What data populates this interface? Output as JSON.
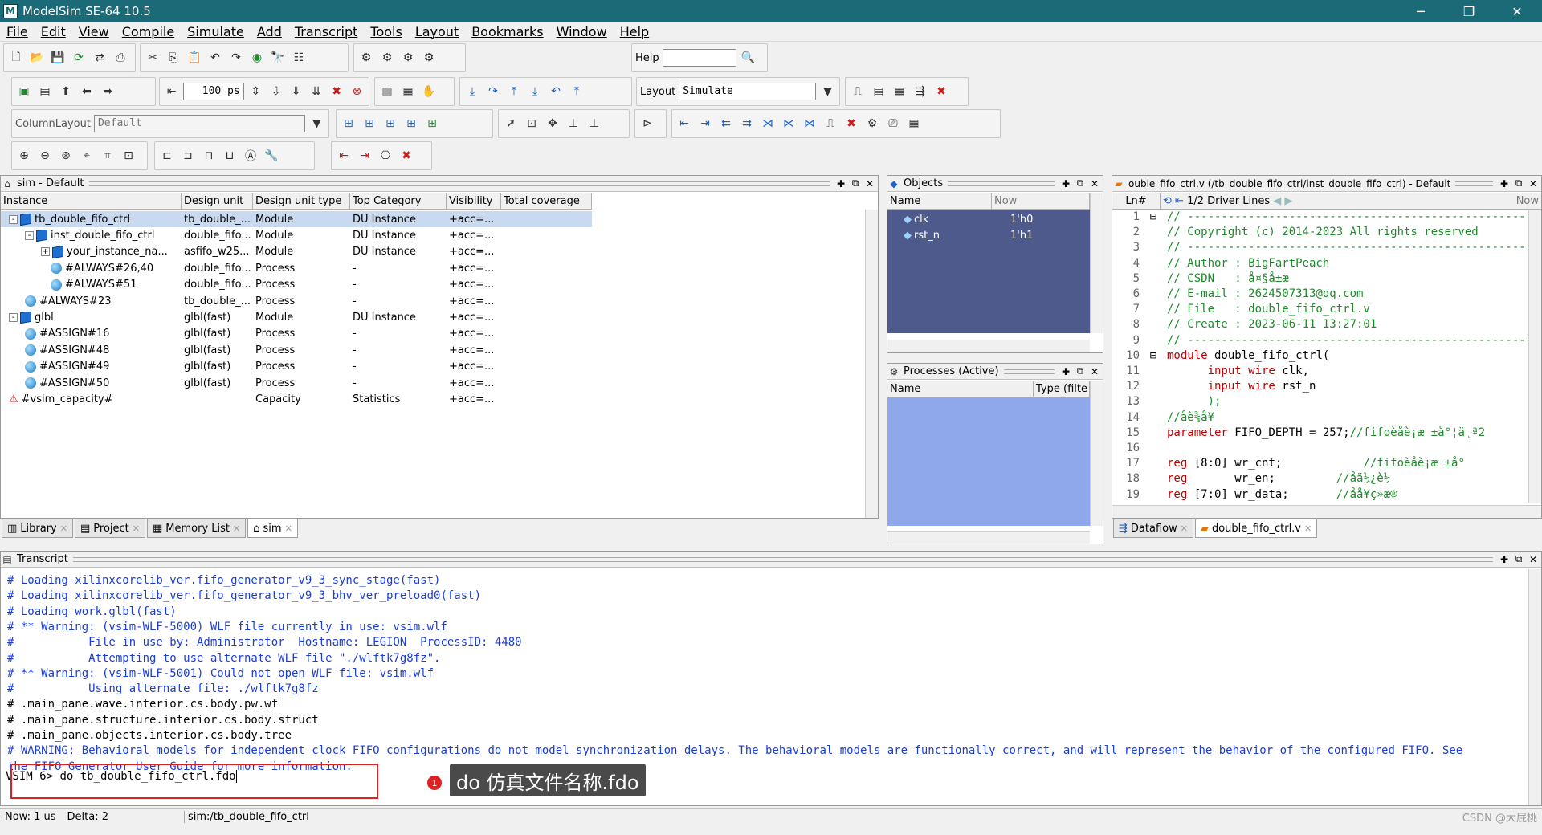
{
  "window": {
    "title": "ModelSim SE-64 10.5",
    "app_icon": "M"
  },
  "menu": [
    "File",
    "Edit",
    "View",
    "Compile",
    "Simulate",
    "Add",
    "Transcript",
    "Tools",
    "Layout",
    "Bookmarks",
    "Window",
    "Help"
  ],
  "toolbar": {
    "help_label": "Help",
    "run_length": "100 ps",
    "layout_label": "Layout",
    "layout_value": "Simulate",
    "column_layout_label": "ColumnLayout",
    "column_layout_value": "Default"
  },
  "sim_panel": {
    "title": "sim - Default",
    "columns": [
      "Instance",
      "Design unit",
      "Design unit type",
      "Top Category",
      "Visibility",
      "Total coverage"
    ],
    "rows": [
      {
        "name": "tb_double_fifo_ctrl",
        "unit": "tb_double_...",
        "type": "Module",
        "cat": "DU Instance",
        "vis": "+acc=..."
      },
      {
        "name": "inst_double_fifo_ctrl",
        "unit": "double_fifo...",
        "type": "Module",
        "cat": "DU Instance",
        "vis": "+acc=..."
      },
      {
        "name": "your_instance_na...",
        "unit": "asfifo_w25...",
        "type": "Module",
        "cat": "DU Instance",
        "vis": "+acc=..."
      },
      {
        "name": "#ALWAYS#26,40",
        "unit": "double_fifo...",
        "type": "Process",
        "cat": "-",
        "vis": "+acc=..."
      },
      {
        "name": "#ALWAYS#51",
        "unit": "double_fifo...",
        "type": "Process",
        "cat": "-",
        "vis": "+acc=..."
      },
      {
        "name": "#ALWAYS#23",
        "unit": "tb_double_...",
        "type": "Process",
        "cat": "-",
        "vis": "+acc=..."
      },
      {
        "name": "glbl",
        "unit": "glbl(fast)",
        "type": "Module",
        "cat": "DU Instance",
        "vis": "+acc=..."
      },
      {
        "name": "#ASSIGN#16",
        "unit": "glbl(fast)",
        "type": "Process",
        "cat": "-",
        "vis": "+acc=..."
      },
      {
        "name": "#ASSIGN#48",
        "unit": "glbl(fast)",
        "type": "Process",
        "cat": "-",
        "vis": "+acc=..."
      },
      {
        "name": "#ASSIGN#49",
        "unit": "glbl(fast)",
        "type": "Process",
        "cat": "-",
        "vis": "+acc=..."
      },
      {
        "name": "#ASSIGN#50",
        "unit": "glbl(fast)",
        "type": "Process",
        "cat": "-",
        "vis": "+acc=..."
      },
      {
        "name": "#vsim_capacity#",
        "unit": "",
        "type": "Capacity",
        "cat": "Statistics",
        "vis": "+acc=..."
      }
    ]
  },
  "left_tabs": [
    "Library",
    "Project",
    "Memory List",
    "sim"
  ],
  "objects_panel": {
    "title": "Objects",
    "col_name": "Name",
    "now_label": "Now",
    "rows": [
      {
        "name": "clk",
        "value": "1'h0"
      },
      {
        "name": "rst_n",
        "value": "1'h1"
      }
    ]
  },
  "processes_panel": {
    "title": "Processes (Active)",
    "col_name": "Name",
    "col_type": "Type (filte"
  },
  "source_panel": {
    "title": "ouble_fifo_ctrl.v (/tb_double_fifo_ctrl/inst_double_fifo_ctrl) - Default",
    "ln_label": "Ln#",
    "driver_label": "1/2 Driver Lines",
    "now_label": "Now",
    "lines": [
      {
        "n": "1",
        "t": "// ---------------------------------------------------------",
        "k": "cm"
      },
      {
        "n": "2",
        "t": "// Copyright (c) 2014-2023 All rights reserved",
        "k": "cm"
      },
      {
        "n": "3",
        "t": "// ---------------------------------------------------------",
        "k": "cm"
      },
      {
        "n": "4",
        "t": "// Author : BigFartPeach",
        "k": "cm"
      },
      {
        "n": "5",
        "t": "// CSDN   : å¤§å±æ",
        "k": "cm"
      },
      {
        "n": "6",
        "t": "// E-mail : 2624507313@qq.com",
        "k": "cm"
      },
      {
        "n": "7",
        "t": "// File   : double_fifo_ctrl.v",
        "k": "cm"
      },
      {
        "n": "8",
        "t": "// Create : 2023-06-11 13:27:01",
        "k": "cm"
      },
      {
        "n": "9",
        "t": "// ---------------------------------------------------------",
        "k": "cm"
      },
      {
        "n": "10",
        "t": "module double_fifo_ctrl(",
        "k": "mod"
      },
      {
        "n": "11",
        "t": "      input wire clk,",
        "k": "in"
      },
      {
        "n": "12",
        "t": "      input wire rst_n",
        "k": "in"
      },
      {
        "n": "13",
        "t": "      );",
        "k": "cm"
      },
      {
        "n": "14",
        "t": "//åè¾å¥",
        "k": "cm"
      },
      {
        "n": "15",
        "t": "parameter FIFO_DEPTH = 257;//fifoèåè¡æ ±å°¦ä¸ª2",
        "k": "par"
      },
      {
        "n": "16",
        "t": "",
        "k": "cm"
      },
      {
        "n": "17",
        "t": "reg [8:0] wr_cnt;            //fifoèåè¡æ ±å°",
        "k": "reg"
      },
      {
        "n": "18",
        "t": "reg       wr_en;         //åä½¿è½",
        "k": "reg"
      },
      {
        "n": "19",
        "t": "reg [7:0] wr_data;       //åå¥ç»æ®",
        "k": "reg"
      }
    ]
  },
  "right_tabs": [
    "Dataflow",
    "double_fifo_ctrl.v"
  ],
  "transcript": {
    "title": "Transcript",
    "lines": [
      {
        "t": "# Loading xilinxcorelib_ver.fifo_generator_v9_3_sync_stage(fast)",
        "c": "b"
      },
      {
        "t": "# Loading xilinxcorelib_ver.fifo_generator_v9_3_bhv_ver_preload0(fast)",
        "c": "b"
      },
      {
        "t": "# Loading work.glbl(fast)",
        "c": "b"
      },
      {
        "t": "# ** Warning: (vsim-WLF-5000) WLF file currently in use: vsim.wlf",
        "c": "b"
      },
      {
        "t": "#           File in use by: Administrator  Hostname: LEGION  ProcessID: 4480",
        "c": "b"
      },
      {
        "t": "#           Attempting to use alternate WLF file \"./wlftk7g8fz\".",
        "c": "b"
      },
      {
        "t": "# ** Warning: (vsim-WLF-5001) Could not open WLF file: vsim.wlf",
        "c": "b"
      },
      {
        "t": "#           Using alternate file: ./wlftk7g8fz",
        "c": "b"
      },
      {
        "t": "# .main_pane.wave.interior.cs.body.pw.wf",
        "c": "k"
      },
      {
        "t": "# .main_pane.structure.interior.cs.body.struct",
        "c": "k"
      },
      {
        "t": "# .main_pane.objects.interior.cs.body.tree",
        "c": "k"
      },
      {
        "t": "# WARNING: Behavioral models for independent clock FIFO configurations do not model synchronization delays. The behavioral models are functionally correct, and will represent the behavior of the configured FIFO. See",
        "c": "b"
      },
      {
        "t": "the FIFO Generator User Guide for more information.",
        "c": "b"
      }
    ],
    "prompt": "VSIM 6> ",
    "command": "do tb_double_fifo_ctrl.fdo"
  },
  "annotation": {
    "badge": "1",
    "label": "do 仿真文件名称.fdo"
  },
  "statusbar": {
    "now": "Now: 1 us",
    "delta": "Delta: 2",
    "context": "sim:/tb_double_fifo_ctrl"
  },
  "watermark": "CSDN @大屁桃"
}
